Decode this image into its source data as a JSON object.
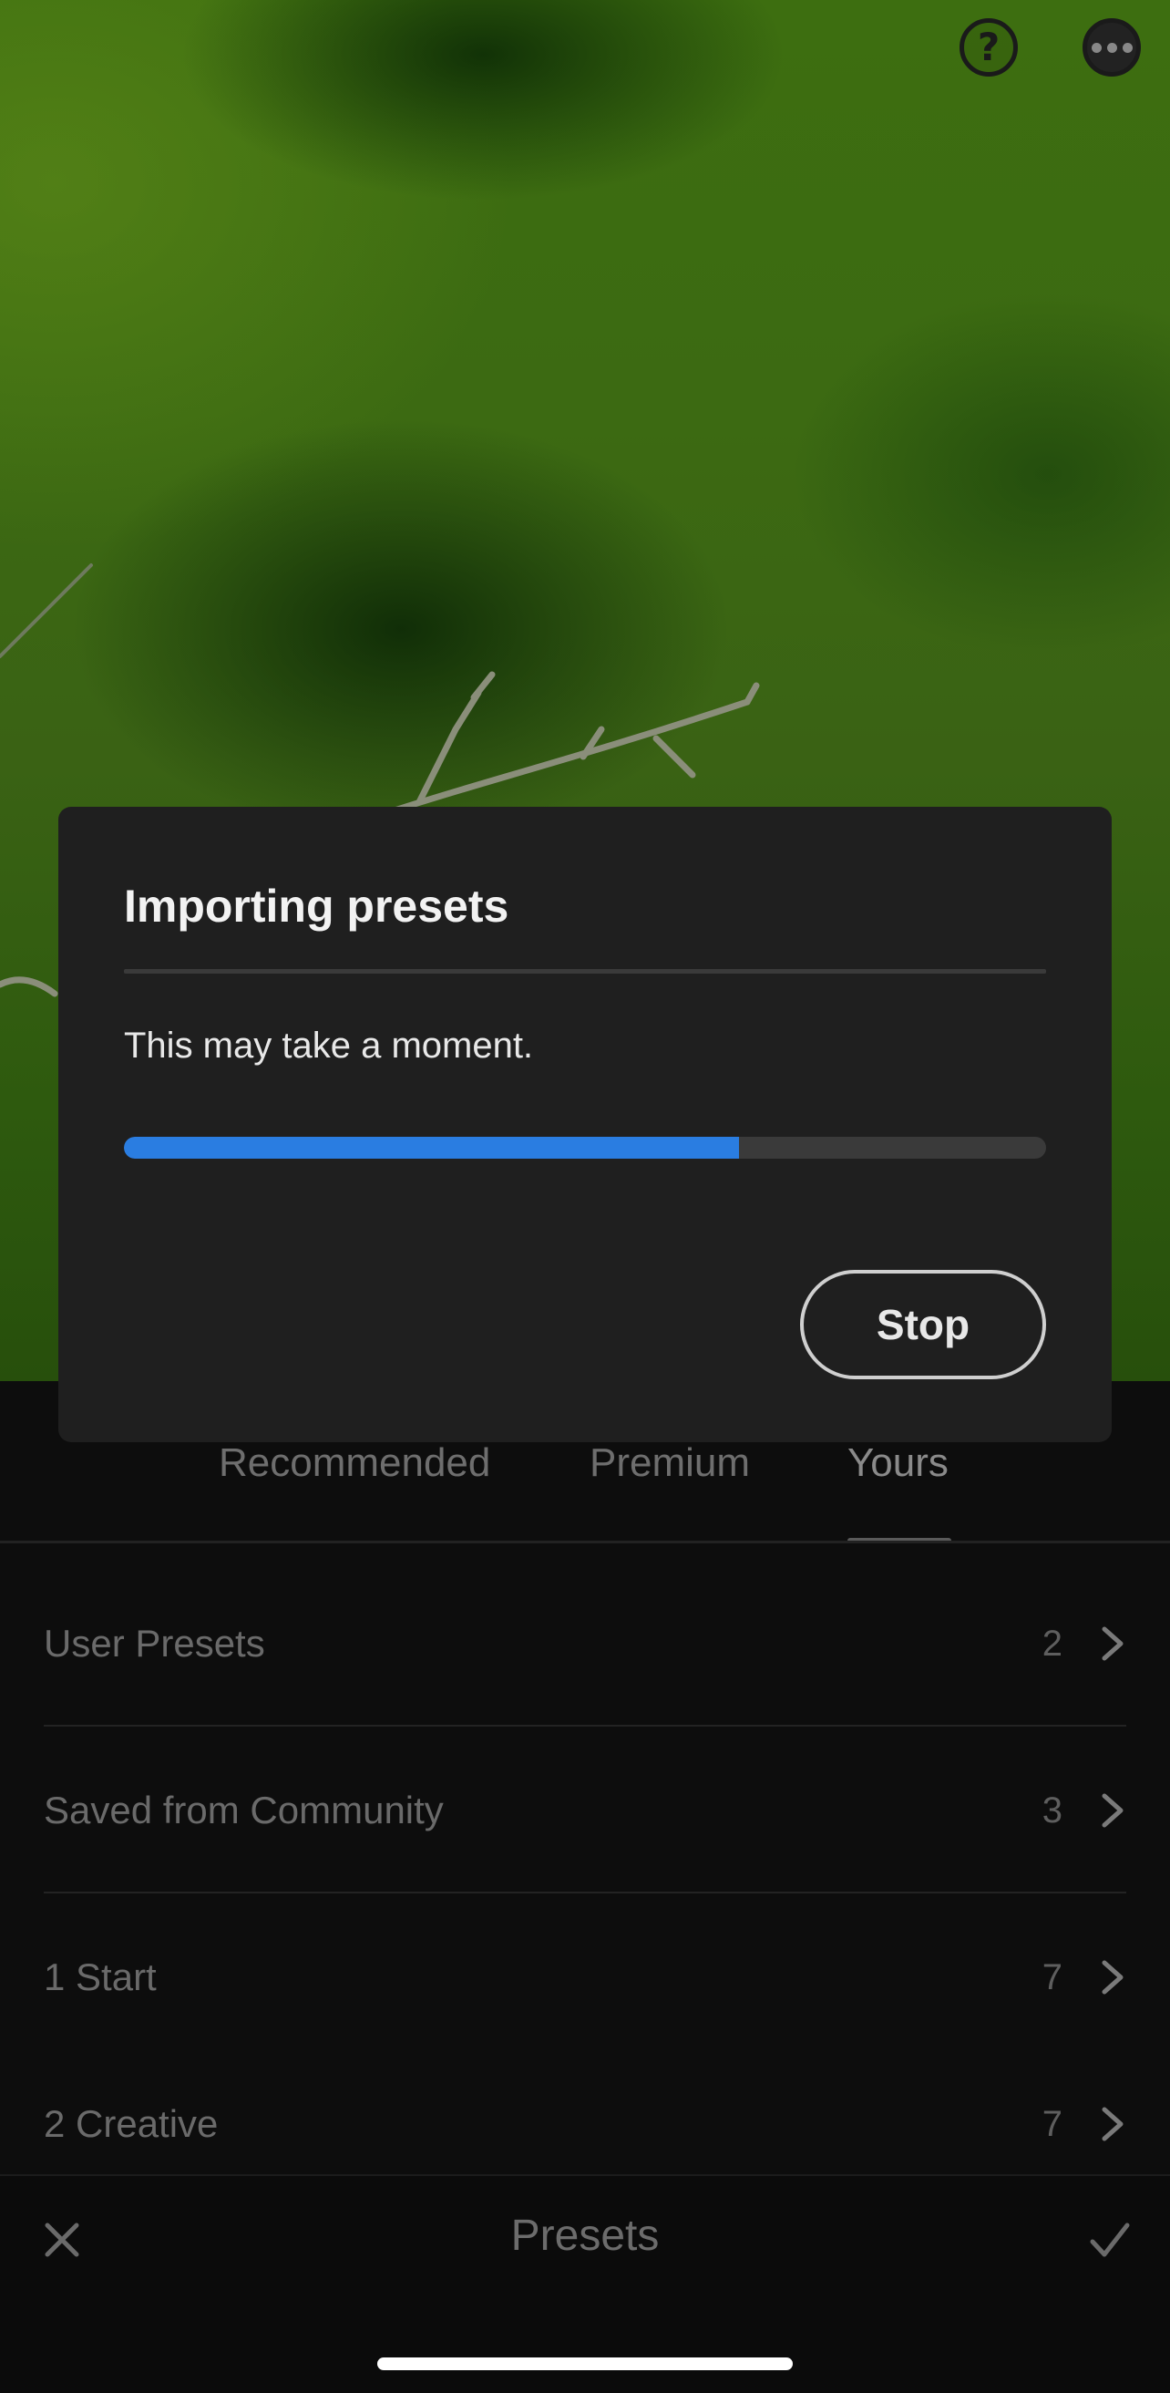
{
  "toolbar": {
    "help_icon": "help-circle-icon",
    "more_icon": "more-options-icon"
  },
  "tabs": [
    {
      "label": "Recommended",
      "selected": false
    },
    {
      "label": "Premium",
      "selected": false
    },
    {
      "label": "Yours",
      "selected": true
    }
  ],
  "preset_groups": [
    {
      "label": "User Presets",
      "count": "2"
    },
    {
      "label": "Saved from Community",
      "count": "3"
    },
    {
      "label": "1 Start",
      "count": "7"
    },
    {
      "label": "2 Creative",
      "count": "7"
    }
  ],
  "bottom_bar": {
    "title": "Presets",
    "close_icon": "close-icon",
    "confirm_icon": "checkmark-icon"
  },
  "dialog": {
    "title": "Importing presets",
    "message": "This may take a moment.",
    "progress": 0.667,
    "stop_label": "Stop",
    "accent_color": "#2a7de1"
  }
}
